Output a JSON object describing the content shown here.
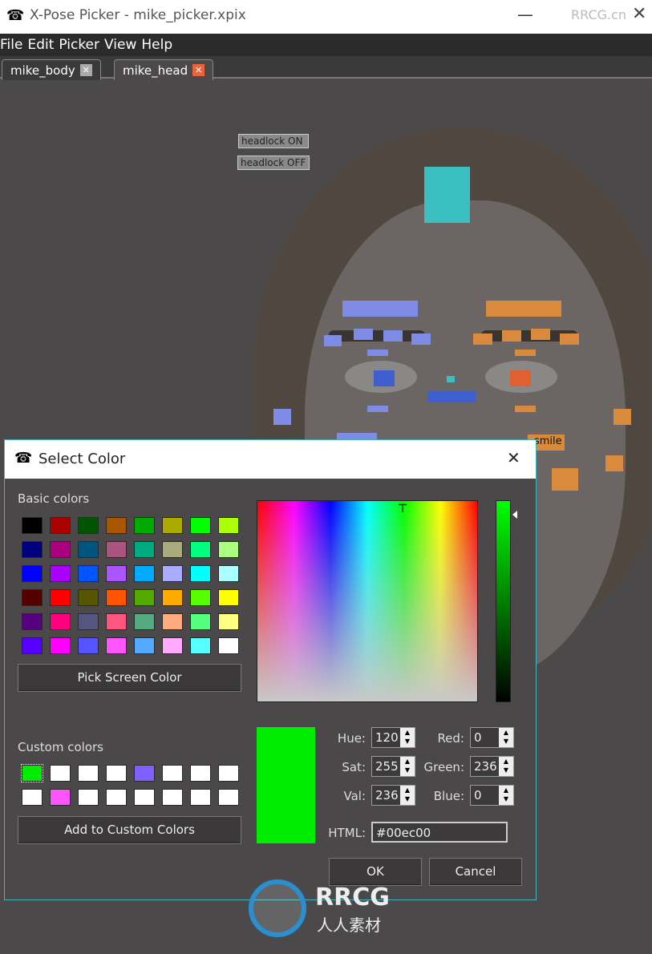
{
  "window": {
    "title": "X-Pose Picker - mike_picker.xpix",
    "watermark_corner": "RRCG.cn"
  },
  "menu": [
    "File",
    "Edit",
    "Picker",
    "View",
    "Help"
  ],
  "tabs": [
    {
      "label": "mike_body",
      "active": false
    },
    {
      "label": "mike_head",
      "active": true
    }
  ],
  "canvas": {
    "buttons": [
      "headlock ON",
      "headlock OFF"
    ],
    "smile_label": "smile"
  },
  "dialog": {
    "title": "Select Color",
    "basic_label": "Basic colors",
    "basic_colors": [
      [
        "#000000",
        "#aa0000",
        "#005500",
        "#aa5500",
        "#00aa00",
        "#aaaa00",
        "#00ff00",
        "#aaff00"
      ],
      [
        "#00007f",
        "#aa007f",
        "#00557f",
        "#aa557f",
        "#00aa7f",
        "#aaaa7f",
        "#00ff7f",
        "#aaff7f"
      ],
      [
        "#0000ff",
        "#aa00ff",
        "#0055ff",
        "#aa55ff",
        "#00aaff",
        "#aaaaff",
        "#00ffff",
        "#aaffff"
      ],
      [
        "#550000",
        "#ff0000",
        "#555500",
        "#ff5500",
        "#55aa00",
        "#ffaa00",
        "#55ff00",
        "#ffff00"
      ],
      [
        "#55007f",
        "#ff007f",
        "#55557f",
        "#ff557f",
        "#55aa7f",
        "#ffaa7f",
        "#55ff7f",
        "#ffff7f"
      ],
      [
        "#5500ff",
        "#ff00ff",
        "#5555ff",
        "#ff55ff",
        "#55aaff",
        "#ffaaff",
        "#55ffff",
        "#ffffff"
      ]
    ],
    "pick_screen": "Pick Screen Color",
    "custom_label": "Custom colors",
    "custom_colors": [
      [
        "#00ec00",
        "#ffffff",
        "#ffffff",
        "#ffffff",
        "#7f5fff",
        "#ffffff",
        "#ffffff",
        "#ffffff"
      ],
      [
        "#ffffff",
        "#ff55ff",
        "#ffffff",
        "#ffffff",
        "#ffffff",
        "#ffffff",
        "#ffffff",
        "#ffffff"
      ]
    ],
    "add_custom": "Add to Custom Colors",
    "current_color": "#00ec00",
    "fields": {
      "hue_label": "Hue:",
      "hue": "120",
      "sat_label": "Sat:",
      "sat": "255",
      "val_label": "Val:",
      "val": "236",
      "red_label": "Red:",
      "red": "0",
      "green_label": "Green:",
      "green": "236",
      "blue_label": "Blue:",
      "blue": "0",
      "html_label": "HTML:",
      "html": "#00ec00"
    },
    "ok": "OK",
    "cancel": "Cancel"
  },
  "watermark": {
    "text": "RRCG",
    "subtext": "人人素材"
  }
}
